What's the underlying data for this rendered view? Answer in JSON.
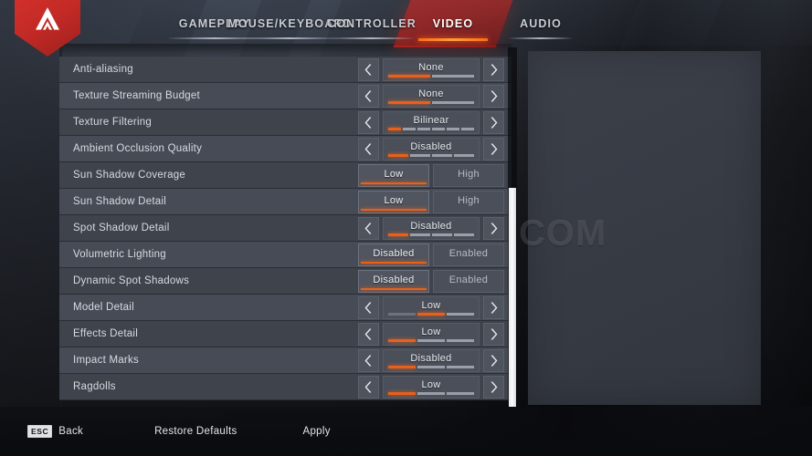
{
  "app": {
    "logo_icon": "apex-legends-logo"
  },
  "nav": {
    "tabs": [
      {
        "label": "GAMEPLAY",
        "active": false
      },
      {
        "label": "MOUSE/KEYBOARD",
        "active": false
      },
      {
        "label": "CONTROLLER",
        "active": false
      },
      {
        "label": "VIDEO",
        "active": true
      },
      {
        "label": "AUDIO",
        "active": false
      }
    ]
  },
  "watermark": {
    "text": "HEAVYBULLETS.COM"
  },
  "settings": {
    "partial_top_row": {
      "label": "",
      "value": ""
    },
    "rows": [
      {
        "label": "Anti-aliasing",
        "type": "stepper",
        "value": "None",
        "segments": 2,
        "filled": 1,
        "prev_icon": "chevron-left-icon",
        "next_icon": "chevron-right-icon"
      },
      {
        "label": "Texture Streaming Budget",
        "type": "stepper",
        "value": "None",
        "segments": 2,
        "filled": 1,
        "prev_icon": "chevron-left-icon",
        "next_icon": "chevron-right-icon"
      },
      {
        "label": "Texture Filtering",
        "type": "stepper",
        "value": "Bilinear",
        "segments": 6,
        "filled": 1,
        "prev_icon": "chevron-left-icon",
        "next_icon": "chevron-right-icon"
      },
      {
        "label": "Ambient Occlusion Quality",
        "type": "stepper",
        "value": "Disabled",
        "segments": 4,
        "filled": 1,
        "prev_icon": "chevron-left-icon",
        "next_icon": "chevron-right-icon"
      },
      {
        "label": "Sun Shadow Coverage",
        "type": "toggle",
        "options": [
          "Low",
          "High"
        ],
        "selected": 0
      },
      {
        "label": "Sun Shadow Detail",
        "type": "toggle",
        "options": [
          "Low",
          "High"
        ],
        "selected": 0
      },
      {
        "label": "Spot Shadow Detail",
        "type": "stepper",
        "value": "Disabled",
        "segments": 4,
        "filled": 1,
        "prev_icon": "chevron-left-icon",
        "next_icon": "chevron-right-icon"
      },
      {
        "label": "Volumetric Lighting",
        "type": "toggle",
        "options": [
          "Disabled",
          "Enabled"
        ],
        "selected": 0
      },
      {
        "label": "Dynamic Spot Shadows",
        "type": "toggle",
        "options": [
          "Disabled",
          "Enabled"
        ],
        "selected": 0
      },
      {
        "label": "Model Detail",
        "type": "stepper",
        "value": "Low",
        "segments": 3,
        "filled": 2,
        "prev_icon": "chevron-left-icon",
        "next_icon": "chevron-right-icon"
      },
      {
        "label": "Effects Detail",
        "type": "stepper",
        "value": "Low",
        "segments": 3,
        "filled": 1,
        "prev_icon": "chevron-left-icon",
        "next_icon": "chevron-right-icon"
      },
      {
        "label": "Impact Marks",
        "type": "stepper",
        "value": "Disabled",
        "segments": 3,
        "filled": 1,
        "prev_icon": "chevron-left-icon",
        "next_icon": "chevron-right-icon"
      },
      {
        "label": "Ragdolls",
        "type": "stepper",
        "value": "Low",
        "segments": 3,
        "filled": 1,
        "prev_icon": "chevron-left-icon",
        "next_icon": "chevron-right-icon"
      }
    ]
  },
  "scrollbar": {
    "thumb_top_pct": 39,
    "thumb_height_pct": 61
  },
  "footer": {
    "back_key": "ESC",
    "back_label": "Back",
    "restore_label": "Restore Defaults",
    "apply_label": "Apply"
  },
  "colors": {
    "accent_orange": "#e8601c",
    "brand_red": "#c62828",
    "row_bg": "#3e434c",
    "row_bg_alt": "#464b55",
    "text": "#d8dbe1"
  }
}
